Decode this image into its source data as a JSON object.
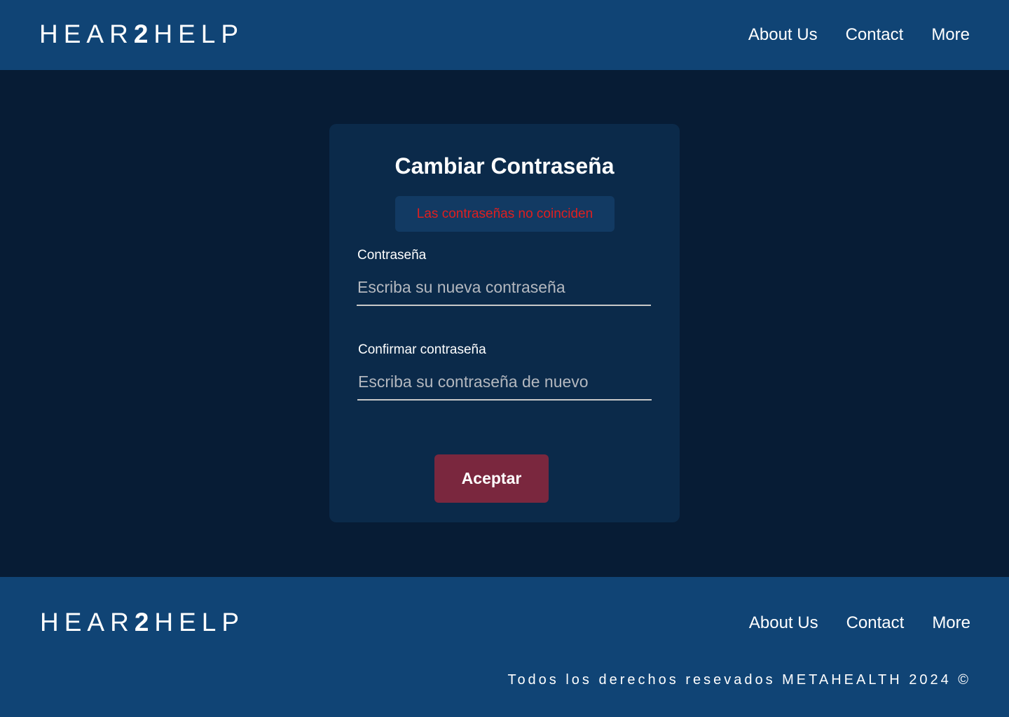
{
  "header": {
    "logo": {
      "part1": "HEAR",
      "part2": "2",
      "part3": "HELP"
    },
    "nav": {
      "about": "About Us",
      "contact": "Contact",
      "more": "More"
    }
  },
  "form": {
    "title": "Cambiar Contraseña",
    "error": "Las contraseñas no coinciden",
    "password": {
      "label": "Contraseña",
      "placeholder": "Escriba su nueva contraseña",
      "value": ""
    },
    "confirm": {
      "label": "Confirmar contraseña",
      "placeholder": "Escriba su contraseña de nuevo",
      "value": ""
    },
    "submit_label": "Aceptar"
  },
  "footer": {
    "logo": {
      "part1": "HEAR",
      "part2": "2",
      "part3": "HELP"
    },
    "nav": {
      "about": "About Us",
      "contact": "Contact",
      "more": "More"
    },
    "copyright": "Todos los derechos resevados METAHEALTH 2024 ©"
  },
  "colors": {
    "header_bg": "#104475",
    "page_bg": "#071c35",
    "card_bg": "#0b2a4a",
    "error_text": "#e01f1f",
    "button_bg": "#7a273e"
  }
}
